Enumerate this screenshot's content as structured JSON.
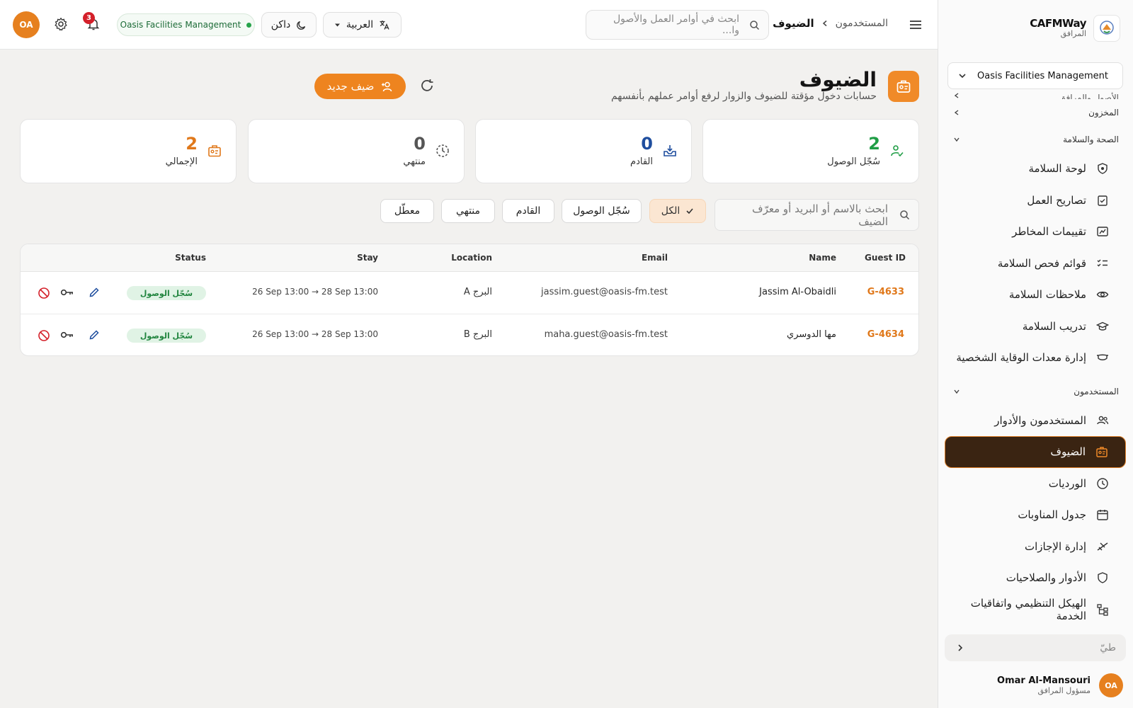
{
  "sidebar": {
    "brand_name": "CAFMWay",
    "brand_sub": "المرافق",
    "org_select": "Oasis Facilities Management",
    "groups": {
      "assets": "الأصول والمرافق",
      "inventory": "المخزون",
      "safety": "الصحة والسلامة",
      "users": "المستخدمون"
    },
    "safety_items": [
      {
        "label": "لوحة السلامة",
        "icon": "shield-star-icon"
      },
      {
        "label": "تصاريح العمل",
        "icon": "clipboard-check-icon"
      },
      {
        "label": "تقييمات المخاطر",
        "icon": "chart-icon"
      },
      {
        "label": "قوائم فحص السلامة",
        "icon": "checklist-icon"
      },
      {
        "label": "ملاحظات السلامة",
        "icon": "eye-icon"
      },
      {
        "label": "تدريب السلامة",
        "icon": "graduation-cap-icon"
      },
      {
        "label": "إدارة معدات الوقاية الشخصية",
        "icon": "mask-icon"
      }
    ],
    "user_items": [
      {
        "label": "المستخدمون والأدوار",
        "icon": "users-icon"
      },
      {
        "label": "الضيوف",
        "icon": "guest-badge-icon"
      },
      {
        "label": "الورديات",
        "icon": "clock-icon"
      },
      {
        "label": "جدول المناوبات",
        "icon": "calendar-icon"
      },
      {
        "label": "إدارة الإجازات",
        "icon": "plane-icon"
      },
      {
        "label": "الأدوار والصلاحيات",
        "icon": "shield-icon"
      },
      {
        "label": "الهيكل التنظيمي واتفاقيات الخدمة",
        "icon": "org-chart-icon"
      }
    ],
    "collapse_label": "طيّ",
    "user_name": "Omar Al-Mansouri",
    "user_role": "مسؤول المرافق",
    "user_initials": "OA"
  },
  "topbar": {
    "breadcrumb_parent": "المستخدمون",
    "breadcrumb_current": "الضيوف",
    "search_placeholder": "ابحث في أوامر العمل والأصول وا...",
    "language": "العربية",
    "theme": "داكن",
    "org_pill": "Oasis Facilities Management",
    "notifications_count": "3",
    "user_initials": "OA"
  },
  "page": {
    "title": "الضيوف",
    "subtitle": "حسابات دخول مؤقتة للضيوف والزوار لرفع أوامر عملهم بأنفسهم",
    "new_button": "ضيف جديد"
  },
  "stats": [
    {
      "value": "2",
      "label": "سُجّل الوصول",
      "color": "#1f9d45"
    },
    {
      "value": "0",
      "label": "القادم",
      "color": "#1f4e9e"
    },
    {
      "value": "0",
      "label": "منتهي",
      "color": "#555555"
    },
    {
      "value": "2",
      "label": "الإجمالي",
      "color": "#e0781a"
    }
  ],
  "filters": {
    "search_placeholder": "ابحث بالاسم أو البريد أو معرّف الضيف",
    "chips": [
      "الكل",
      "سُجّل الوصول",
      "القادم",
      "منتهي",
      "معطّل"
    ],
    "active": "الكل"
  },
  "table": {
    "headers": {
      "guest_id": "Guest ID",
      "name": "Name",
      "email": "Email",
      "location": "Location",
      "stay": "Stay",
      "status": "Status"
    },
    "rows": [
      {
        "guest_id": "G-4633",
        "name": "Jassim Al-Obaidli",
        "email": "jassim.guest@oasis-fm.test",
        "location": "البرج A",
        "stay": "26 Sep 13:00 → 28 Sep 13:00",
        "status": "سُجّل الوصول"
      },
      {
        "guest_id": "G-4634",
        "name": "مها الدوسري",
        "email": "maha.guest@oasis-fm.test",
        "location": "البرج B",
        "stay": "26 Sep 13:00 → 28 Sep 13:00",
        "status": "سُجّل الوصول"
      }
    ]
  },
  "colors": {
    "accent": "#ee841f",
    "sidebar_active_bg": "#3a2412",
    "success": "#1f9d45",
    "danger": "#d4202a"
  }
}
